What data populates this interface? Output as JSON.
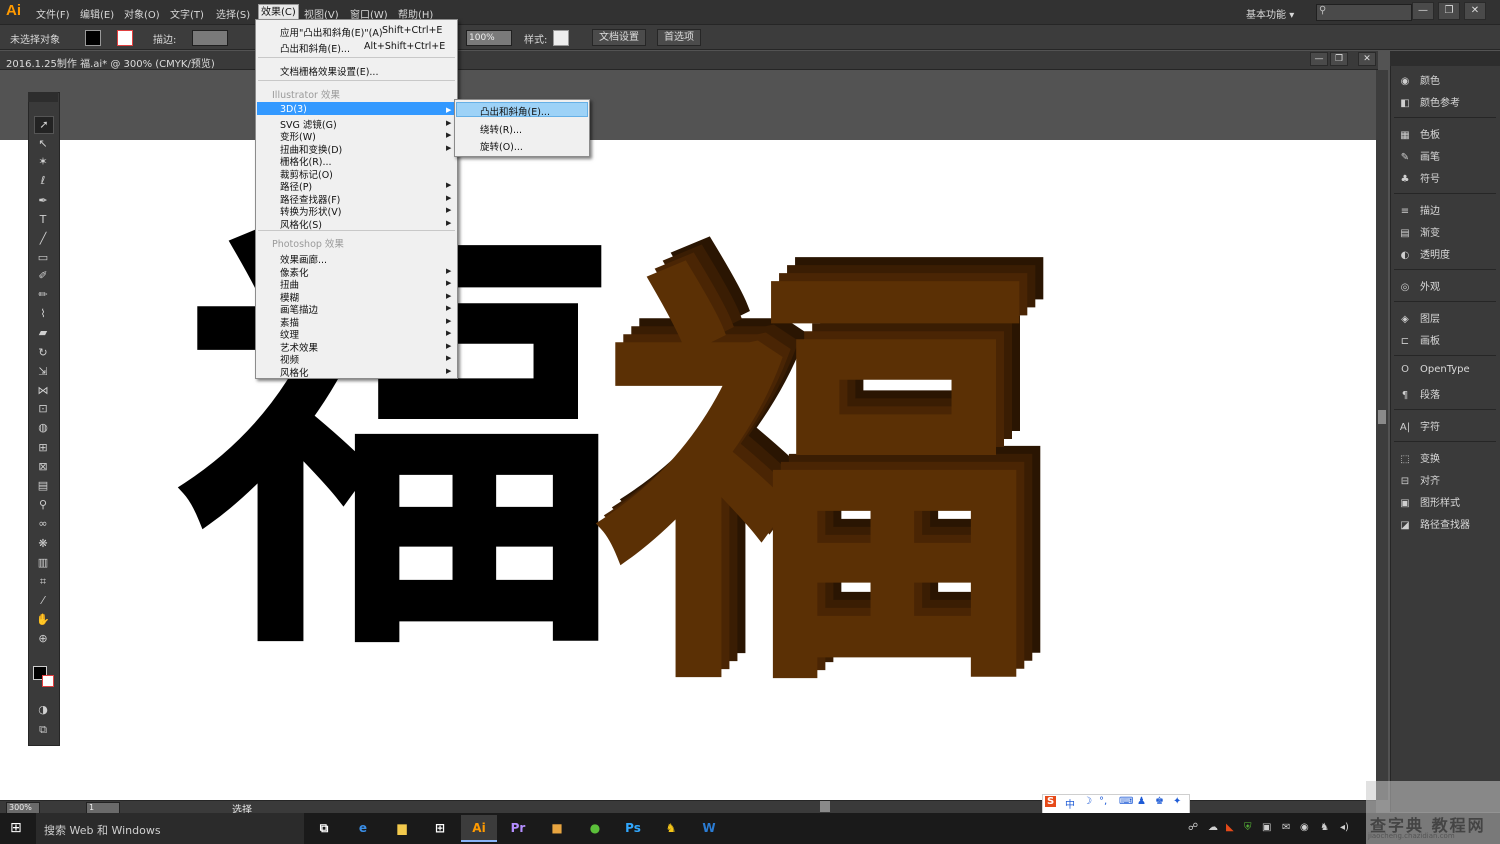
{
  "app": {
    "logo": "Ai",
    "workspace": "基本功能",
    "workspace_chevron": "▾"
  },
  "menubar": {
    "items": [
      "文件(F)",
      "编辑(E)",
      "对象(O)",
      "文字(T)",
      "选择(S)",
      "效果(C)",
      "视图(V)",
      "窗口(W)",
      "帮助(H)"
    ],
    "active_index": 5
  },
  "window_controls": [
    "—",
    "❐",
    "✕"
  ],
  "controlbar": {
    "no_selection": "未选择对象",
    "stroke_label": "描边:",
    "opacity_value": "100%",
    "style_label": "样式:",
    "doc_setup": "文档设置",
    "preferences": "首选项"
  },
  "document": {
    "tab_title": "2016.1.25制作 福.ai* @ 300% (CMYK/预览)",
    "close": "✕"
  },
  "artwork": {
    "glyph": "福"
  },
  "effect_menu": {
    "apply_last": "应用\"凸出和斜角(E)\"(A)",
    "apply_last_shortcut": "Shift+Ctrl+E",
    "last_effect": "凸出和斜角(E)...",
    "last_effect_shortcut": "Alt+Shift+Ctrl+E",
    "raster_settings": "文档栅格效果设置(E)...",
    "illustrator_header": "Illustrator 效果",
    "illustrator_items": [
      "3D(3)",
      "SVG 滤镜(G)",
      "变形(W)",
      "扭曲和变换(D)",
      "栅格化(R)...",
      "裁剪标记(O)",
      "路径(P)",
      "路径查找器(F)",
      "转换为形状(V)",
      "风格化(S)"
    ],
    "illustrator_has_sub": [
      true,
      true,
      true,
      true,
      false,
      false,
      true,
      true,
      true,
      true
    ],
    "photoshop_header": "Photoshop 效果",
    "photoshop_items": [
      "效果画廊...",
      "像素化",
      "扭曲",
      "模糊",
      "画笔描边",
      "素描",
      "纹理",
      "艺术效果",
      "视频",
      "风格化"
    ]
  },
  "submenu_3d": {
    "items": [
      "凸出和斜角(E)...",
      "绕转(R)...",
      "旋转(O)..."
    ],
    "highlight_index": 0
  },
  "right_panel": {
    "items": [
      {
        "icon": "color-icon",
        "glyph": "◉",
        "label": "颜色"
      },
      {
        "icon": "color-guide-icon",
        "glyph": "◧",
        "label": "颜色参考"
      },
      {
        "icon": "swatches-icon",
        "glyph": "▦",
        "label": "色板"
      },
      {
        "icon": "brushes-icon",
        "glyph": "✎",
        "label": "画笔"
      },
      {
        "icon": "symbols-icon",
        "glyph": "♣",
        "label": "符号"
      },
      {
        "icon": "stroke-icon",
        "glyph": "≡",
        "label": "描边"
      },
      {
        "icon": "gradient-icon",
        "glyph": "▤",
        "label": "渐变"
      },
      {
        "icon": "transparency-icon",
        "glyph": "◐",
        "label": "透明度"
      },
      {
        "icon": "appearance-icon",
        "glyph": "◎",
        "label": "外观"
      },
      {
        "icon": "layers-icon",
        "glyph": "◈",
        "label": "图层"
      },
      {
        "icon": "artboards-icon",
        "glyph": "⊏",
        "label": "画板"
      },
      {
        "icon": "opentype-icon",
        "glyph": "O",
        "label": "OpenType"
      },
      {
        "icon": "paragraph-icon",
        "glyph": "¶",
        "label": "段落"
      },
      {
        "icon": "character-icon",
        "glyph": "A|",
        "label": "字符"
      },
      {
        "icon": "transform-icon",
        "glyph": "⬚",
        "label": "变换"
      },
      {
        "icon": "align-icon",
        "glyph": "⊟",
        "label": "对齐"
      },
      {
        "icon": "graphic-styles-icon",
        "glyph": "▣",
        "label": "图形样式"
      },
      {
        "icon": "pathfinder-icon",
        "glyph": "◪",
        "label": "路径查找器"
      }
    ]
  },
  "statusbar": {
    "zoom": "300%",
    "artboard": "1",
    "mode": "选择"
  },
  "taskbar": {
    "search_placeholder": "搜索 Web 和 Windows",
    "apps": [
      {
        "name": "task-view",
        "glyph": "⧉",
        "color": "#ffffff"
      },
      {
        "name": "edge",
        "glyph": "e",
        "color": "#3a8ee6"
      },
      {
        "name": "file-explorer",
        "glyph": "▆",
        "color": "#f2c94c"
      },
      {
        "name": "store",
        "glyph": "⊞",
        "color": "#ffffff"
      },
      {
        "name": "illustrator",
        "glyph": "Ai",
        "color": "#ff9a00"
      },
      {
        "name": "premiere",
        "glyph": "Pr",
        "color": "#b48eff"
      },
      {
        "name": "package",
        "glyph": "■",
        "color": "#e8a540"
      },
      {
        "name": "360",
        "glyph": "●",
        "color": "#5bbf3a"
      },
      {
        "name": "photoshop",
        "glyph": "Ps",
        "color": "#31a8ff"
      },
      {
        "name": "qq",
        "glyph": "♞",
        "color": "#f5c518"
      },
      {
        "name": "word",
        "glyph": "W",
        "color": "#2b7cd3"
      }
    ],
    "active_app": "illustrator"
  },
  "watermark": {
    "text": "查字典 教程网",
    "url": "jiaocheng.chazidian.com"
  },
  "colors": {
    "accent": "#3399ff",
    "submenu_highlight": "#9dd2f7",
    "glyph_front": "#5b3005",
    "glyph_side": "#3a1d03"
  }
}
